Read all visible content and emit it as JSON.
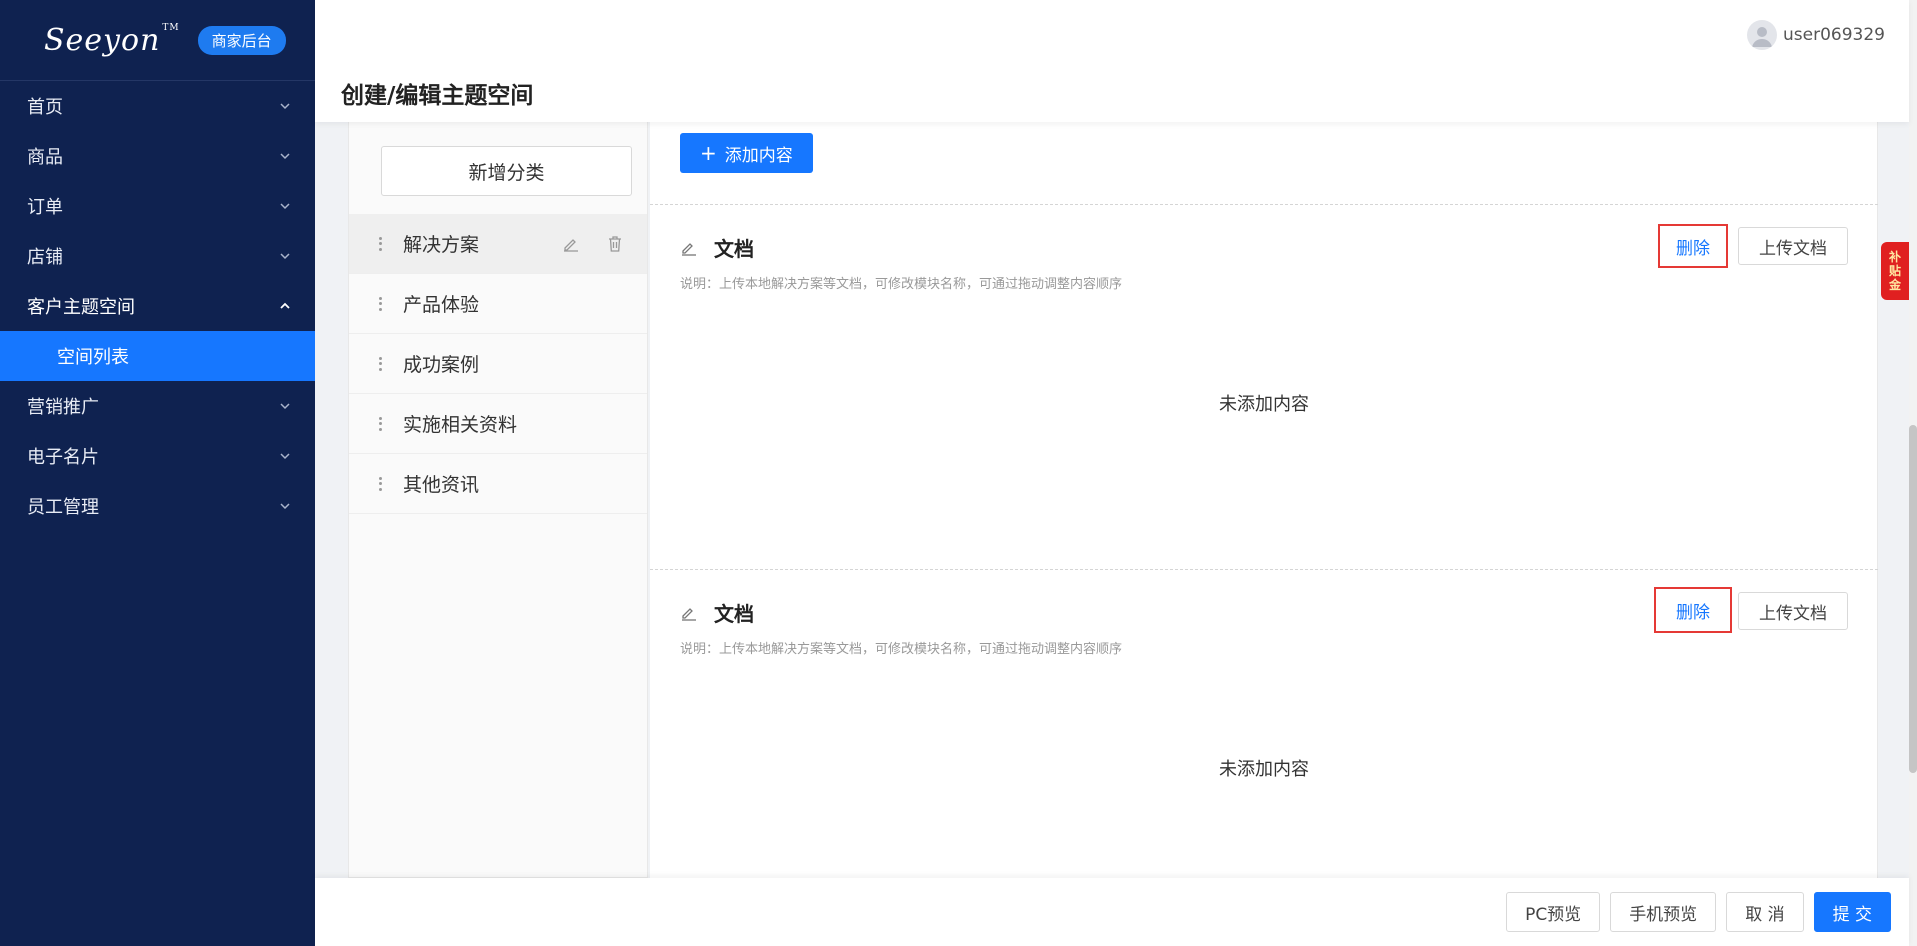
{
  "sidebar": {
    "logo": "Seeyon",
    "logo_tm": "TM",
    "badge": "商家后台",
    "items": [
      {
        "label": "首页"
      },
      {
        "label": "商品"
      },
      {
        "label": "订单"
      },
      {
        "label": "店铺"
      },
      {
        "label": "客户主题空间",
        "sub": "空间列表"
      },
      {
        "label": "营销推广"
      },
      {
        "label": "电子名片"
      },
      {
        "label": "员工管理"
      }
    ]
  },
  "header": {
    "title": "创建/编辑主题空间",
    "username": "user069329"
  },
  "categories": {
    "add_label": "新增分类",
    "items": [
      "解决方案",
      "产品体验",
      "成功案例",
      "实施相关资料",
      "其他资讯"
    ]
  },
  "content": {
    "add_label": "添加内容",
    "modules": [
      {
        "title": "文档",
        "desc": "说明：上传本地解决方案等文档，可修改模块名称，可通过拖动调整内容顺序",
        "delete_label": "删除",
        "upload_label": "上传文档",
        "empty": "未添加内容"
      },
      {
        "title": "文档",
        "desc": "说明：上传本地解决方案等文档，可修改模块名称，可通过拖动调整内容顺序",
        "delete_label": "删除",
        "upload_label": "上传文档",
        "empty": "未添加内容"
      }
    ]
  },
  "footer": {
    "pc_preview": "PC预览",
    "mobile_preview": "手机预览",
    "cancel": "取 消",
    "submit": "提 交"
  },
  "float_tag": [
    "补",
    "贴",
    "金"
  ]
}
